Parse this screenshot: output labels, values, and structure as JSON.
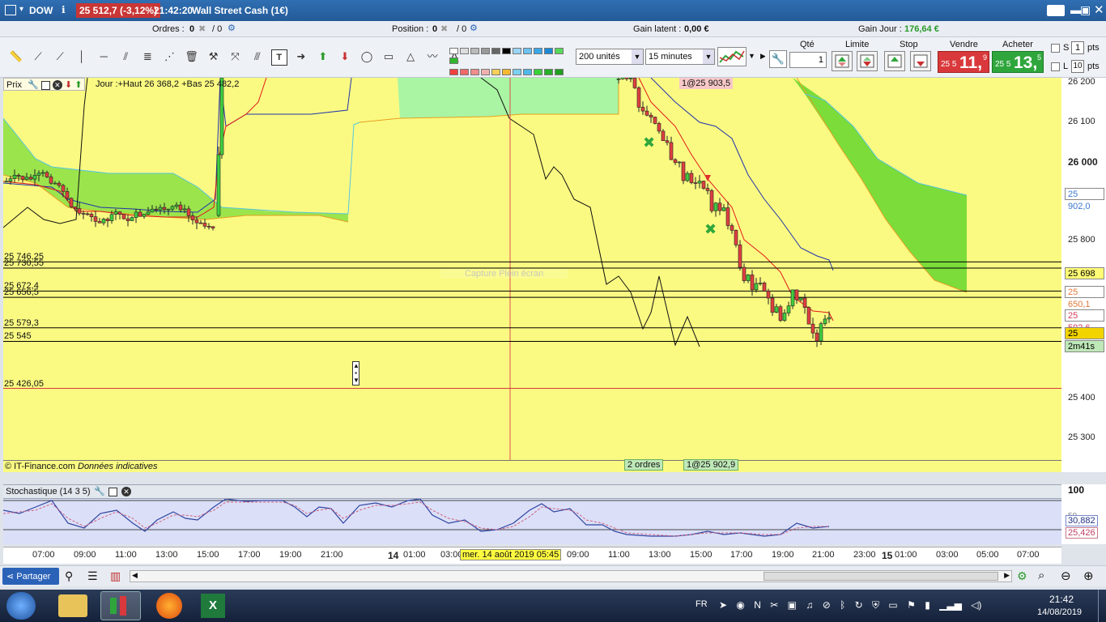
{
  "titlebar": {
    "app_menu": "DOW",
    "price_badge": "25 512,7 (-3,12%)",
    "time": "21:42:20",
    "instrument": "Wall Street Cash (1€)"
  },
  "infobar": {
    "orders_label": "Ordres :",
    "orders_value": "0",
    "orders_sep": "/ 0",
    "position_label": "Position :",
    "position_value": "0",
    "position_sep": "/ 0",
    "gain_latent_label": "Gain latent :",
    "gain_latent_value": "0,00 €",
    "gain_jour_label": "Gain Jour :",
    "gain_jour_value": "176,64 €"
  },
  "toolbar": {
    "units_select": "200 unités",
    "interval_select": "15 minutes"
  },
  "order_panel": {
    "qty_label": "Qté",
    "qty_value": "1",
    "limit_label": "Limite",
    "stop_label": "Stop",
    "sell_label": "Vendre",
    "buy_label": "Acheter",
    "sell_price_small": "25 5",
    "sell_price_big": "11,",
    "sell_price_sup": "9",
    "buy_price_small": "25 5",
    "buy_price_big": "13,",
    "buy_price_sup": "5",
    "s_label": "S",
    "s_value": "1",
    "l_label": "L",
    "l_value": "10",
    "pts": "pts"
  },
  "chart": {
    "legend_prix": "Prix",
    "legend_text": "Jour :+Haut 26 368,2 +Bas 25 482,2",
    "order_tag_top": "1@25 903,5",
    "order_tag_bottom": "1@25 902,9",
    "orders_count_tag": "2 ordres",
    "copyright": "© IT-Finance.com",
    "disclaimer": "Données indicatives",
    "watermark": "Capture Plein écran",
    "levels": [
      {
        "label": "25 746,25",
        "price": 25746.25,
        "color": "#000000"
      },
      {
        "label": "25 730,55",
        "price": 25730.55,
        "color": "#000000"
      },
      {
        "label": "25 672,4",
        "price": 25672.4,
        "color": "#000000"
      },
      {
        "label": "25 656,5",
        "price": 25656.5,
        "color": "#000000"
      },
      {
        "label": "25 579,3",
        "price": 25579.3,
        "color": "#000000"
      },
      {
        "label": "25 545",
        "price": 25545,
        "color": "#000000"
      },
      {
        "label": "25 426,05",
        "price": 25426.05,
        "color": "#d23c3c"
      }
    ],
    "price_ticks": [
      "26 200",
      "26 100",
      "26 000",
      "25 800",
      "25 400",
      "25 300"
    ],
    "price_tags": [
      {
        "text": "25 902,0",
        "bg": "#ffffff",
        "fg": "#3a7ad0"
      },
      {
        "text": "25 698",
        "bg": "#fffb75",
        "fg": "#000000"
      },
      {
        "text": "25 650,1",
        "bg": "#ffffff",
        "fg": "#e07a3a"
      },
      {
        "text": "25 592,6",
        "bg": "#ffffff",
        "fg": "#d23c5a"
      },
      {
        "text": "25 513,2",
        "bg": "#f2d400",
        "fg": "#000000"
      },
      {
        "text": "2m41s",
        "bg": "#bfe8b8",
        "fg": "#000000"
      }
    ]
  },
  "stoch": {
    "title": "Stochastique (14 3 5)",
    "axis_top": "100",
    "axis_mid": "50",
    "value_1": "30,882",
    "value_2": "25,426"
  },
  "time_axis": {
    "labels": [
      "07:00",
      "09:00",
      "11:00",
      "13:00",
      "15:00",
      "17:00",
      "19:00",
      "21:00",
      "14",
      "01:00",
      "03:00",
      "09:00",
      "11:00",
      "13:00",
      "15:00",
      "17:00",
      "19:00",
      "21:00",
      "23:00",
      "15",
      "01:00",
      "03:00",
      "05:00",
      "07:00"
    ],
    "cursor_label": "mer. 14 août 2019 05:45"
  },
  "bottom": {
    "share_label": "Partager"
  },
  "taskbar": {
    "lang": "FR",
    "clock_time": "21:42",
    "clock_date": "14/08/2019"
  },
  "colors": {
    "cloud_green": "#7bdc3a",
    "chart_bg": "#fafa82",
    "sell_red": "#d9393c",
    "buy_green": "#2fa63c"
  }
}
